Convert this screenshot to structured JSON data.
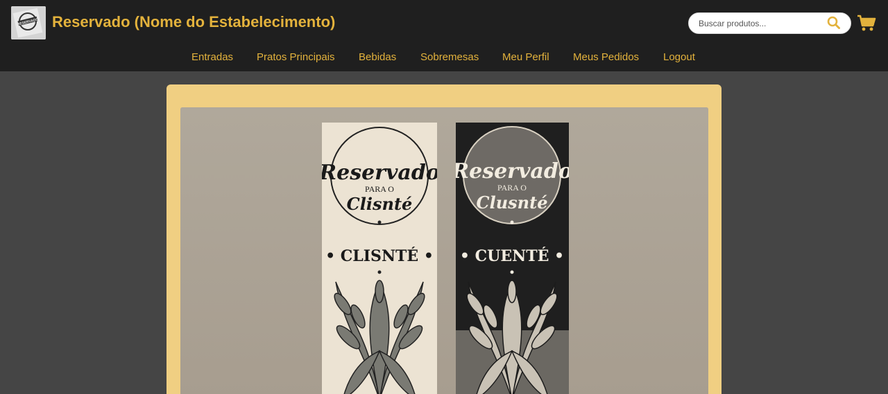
{
  "header": {
    "title": "Reservado (Nome do Estabelecimento)",
    "logo_text": "RESERVADO",
    "search": {
      "placeholder": "Buscar produtos...",
      "icon": "search-icon"
    },
    "cart": {
      "icon": "cart-icon"
    }
  },
  "nav": {
    "items": [
      {
        "label": "Entradas"
      },
      {
        "label": "Pratos Principais"
      },
      {
        "label": "Bebidas"
      },
      {
        "label": "Sobremesas"
      },
      {
        "label": "Meu Perfil"
      },
      {
        "label": "Meus Pedidos"
      },
      {
        "label": "Logout"
      }
    ]
  },
  "product_image": {
    "tags": [
      {
        "script_word": "Reservado",
        "sub_word": "PARA O",
        "script_word2": "Clisnté",
        "label": "• CLISNTÉ •"
      },
      {
        "script_word": "Reservado",
        "sub_word": "PARA O",
        "script_word2": "Clusnté",
        "label": "• CUENTÉ •"
      }
    ]
  },
  "colors": {
    "accent": "#e3b23c",
    "header_bg": "#1f1f1f",
    "page_bg": "#454545",
    "card_bg": "#f0cf82"
  }
}
